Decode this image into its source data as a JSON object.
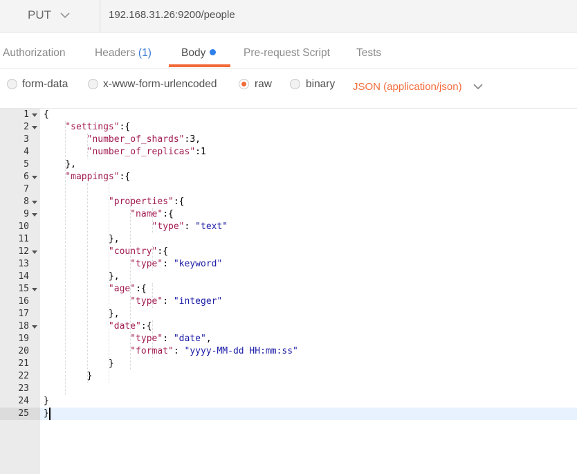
{
  "request": {
    "method": "PUT",
    "url": "192.168.31.26:9200/people"
  },
  "tabs": {
    "authorization": "Authorization",
    "headers": "Headers",
    "headers_count": "(1)",
    "body": "Body",
    "prerequest": "Pre-request Script",
    "tests": "Tests"
  },
  "body_types": {
    "form_data": "form-data",
    "urlencoded": "x-www-form-urlencoded",
    "raw": "raw",
    "binary": "binary",
    "selected": "raw",
    "content_type": "JSON (application/json)"
  },
  "colors": {
    "accent": "#f26b3a",
    "header_count": "#3b7bd6",
    "json_key": "#a11a50",
    "json_string": "#1a1aa6"
  },
  "editor": {
    "line_numbers": [
      "1",
      "2",
      "3",
      "4",
      "5",
      "6",
      "7",
      "8",
      "9",
      "10",
      "11",
      "12",
      "13",
      "14",
      "15",
      "16",
      "17",
      "18",
      "19",
      "20",
      "21",
      "22",
      "23",
      "24",
      "25"
    ],
    "active_line": "25",
    "lines": [
      [
        {
          "t": "p",
          "v": "{"
        }
      ],
      [
        {
          "t": "p",
          "v": "    "
        },
        {
          "t": "k",
          "v": "\"settings\""
        },
        {
          "t": "p",
          "v": ":{"
        }
      ],
      [
        {
          "t": "p",
          "v": "        "
        },
        {
          "t": "k",
          "v": "\"number_of_shards\""
        },
        {
          "t": "p",
          "v": ":3,"
        }
      ],
      [
        {
          "t": "p",
          "v": "        "
        },
        {
          "t": "k",
          "v": "\"number_of_replicas\""
        },
        {
          "t": "p",
          "v": ":1"
        }
      ],
      [
        {
          "t": "p",
          "v": "    },"
        }
      ],
      [
        {
          "t": "p",
          "v": "    "
        },
        {
          "t": "k",
          "v": "\"mappings\""
        },
        {
          "t": "p",
          "v": ":{"
        }
      ],
      [
        {
          "t": "p",
          "v": ""
        }
      ],
      [
        {
          "t": "p",
          "v": "            "
        },
        {
          "t": "k",
          "v": "\"properties\""
        },
        {
          "t": "p",
          "v": ":{"
        }
      ],
      [
        {
          "t": "p",
          "v": "                "
        },
        {
          "t": "k",
          "v": "\"name\""
        },
        {
          "t": "p",
          "v": ":{"
        }
      ],
      [
        {
          "t": "p",
          "v": "                    "
        },
        {
          "t": "k",
          "v": "\"type\""
        },
        {
          "t": "p",
          "v": ": "
        },
        {
          "t": "s",
          "v": "\"text\""
        }
      ],
      [
        {
          "t": "p",
          "v": "            },"
        }
      ],
      [
        {
          "t": "p",
          "v": "            "
        },
        {
          "t": "k",
          "v": "\"country\""
        },
        {
          "t": "p",
          "v": ":{"
        }
      ],
      [
        {
          "t": "p",
          "v": "                "
        },
        {
          "t": "k",
          "v": "\"type\""
        },
        {
          "t": "p",
          "v": ": "
        },
        {
          "t": "s",
          "v": "\"keyword\""
        }
      ],
      [
        {
          "t": "p",
          "v": "            },"
        }
      ],
      [
        {
          "t": "p",
          "v": "            "
        },
        {
          "t": "k",
          "v": "\"age\""
        },
        {
          "t": "p",
          "v": ":{"
        }
      ],
      [
        {
          "t": "p",
          "v": "                "
        },
        {
          "t": "k",
          "v": "\"type\""
        },
        {
          "t": "p",
          "v": ": "
        },
        {
          "t": "s",
          "v": "\"integer\""
        }
      ],
      [
        {
          "t": "p",
          "v": "            },"
        }
      ],
      [
        {
          "t": "p",
          "v": "            "
        },
        {
          "t": "k",
          "v": "\"date\""
        },
        {
          "t": "p",
          "v": ":{"
        }
      ],
      [
        {
          "t": "p",
          "v": "                "
        },
        {
          "t": "k",
          "v": "\"type\""
        },
        {
          "t": "p",
          "v": ": "
        },
        {
          "t": "s",
          "v": "\"date\""
        },
        {
          "t": "p",
          "v": ","
        }
      ],
      [
        {
          "t": "p",
          "v": "                "
        },
        {
          "t": "k",
          "v": "\"format\""
        },
        {
          "t": "p",
          "v": ": "
        },
        {
          "t": "s",
          "v": "\"yyyy-MM-dd HH:mm:ss\""
        }
      ],
      [
        {
          "t": "p",
          "v": "            }"
        }
      ],
      [
        {
          "t": "p",
          "v": "        }"
        }
      ],
      [
        {
          "t": "p",
          "v": ""
        }
      ],
      [
        {
          "t": "p",
          "v": "}"
        }
      ],
      [
        {
          "t": "p",
          "v": "}"
        }
      ]
    ],
    "foldable_lines": [
      "1",
      "2",
      "6",
      "8",
      "9",
      "12",
      "15",
      "18"
    ]
  }
}
